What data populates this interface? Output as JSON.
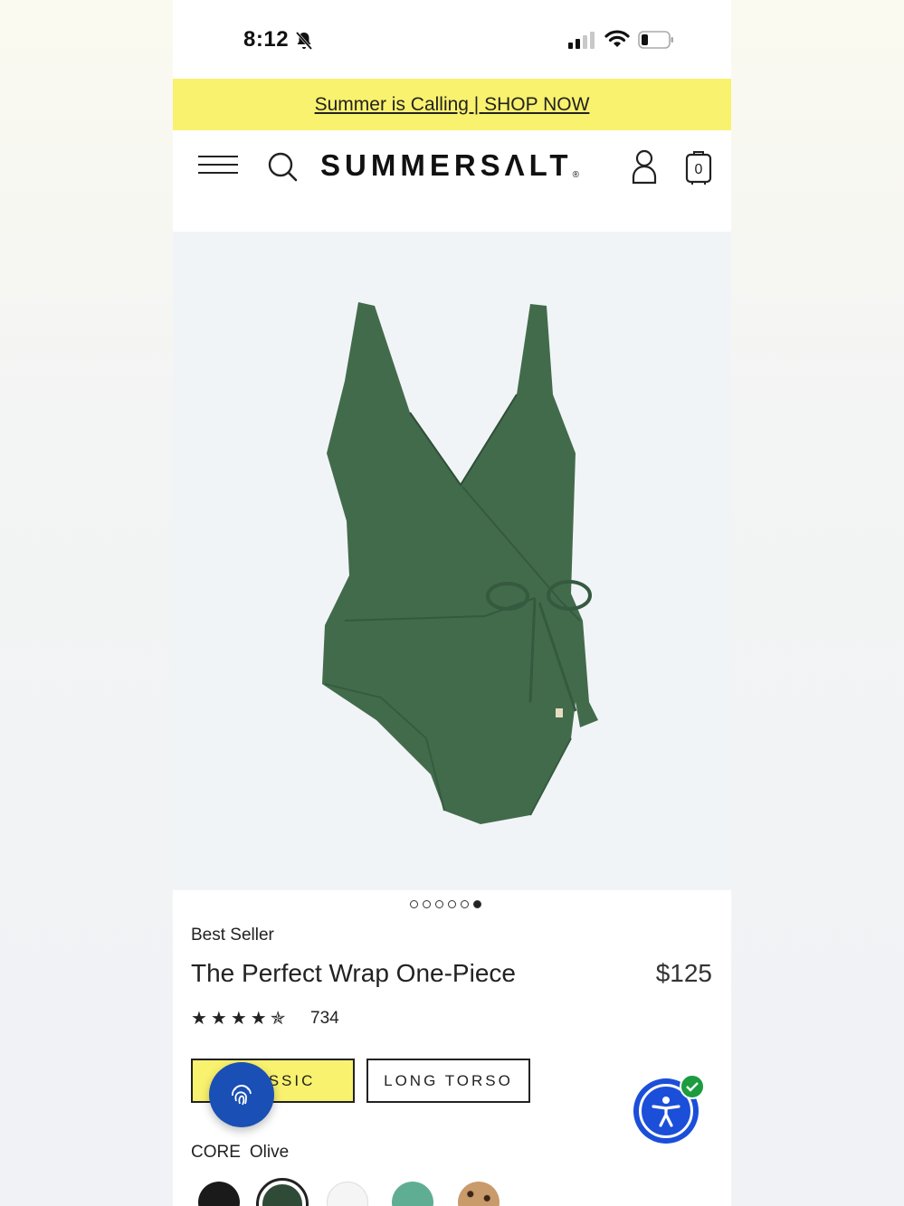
{
  "status": {
    "time": "8:12"
  },
  "promo": {
    "text": "Summer is Calling | SHOP NOW"
  },
  "nav": {
    "logo": "SUMMERSΛLT",
    "logo_mark": "®",
    "cart_count": "0"
  },
  "gallery": {
    "total": 6,
    "active": 6,
    "product_color": "#426b4b"
  },
  "product": {
    "badge": "Best Seller",
    "title": "The Perfect Wrap One-Piece",
    "price": "$125",
    "rating": 4.5,
    "rating_stars": "★★★★✯",
    "review_count": "734"
  },
  "fit": {
    "classic_label": "CLASSIC",
    "long_label": "LONG TORSO"
  },
  "colors": {
    "collection": "CORE",
    "selected": "Olive",
    "swatches": [
      "#1a1a1a",
      "#2f4a36",
      "#f5f5f5",
      "#5fae93",
      "leopard"
    ]
  },
  "theme": {
    "accent": "#f9f26e",
    "button_blue": "#1b4fd9"
  }
}
